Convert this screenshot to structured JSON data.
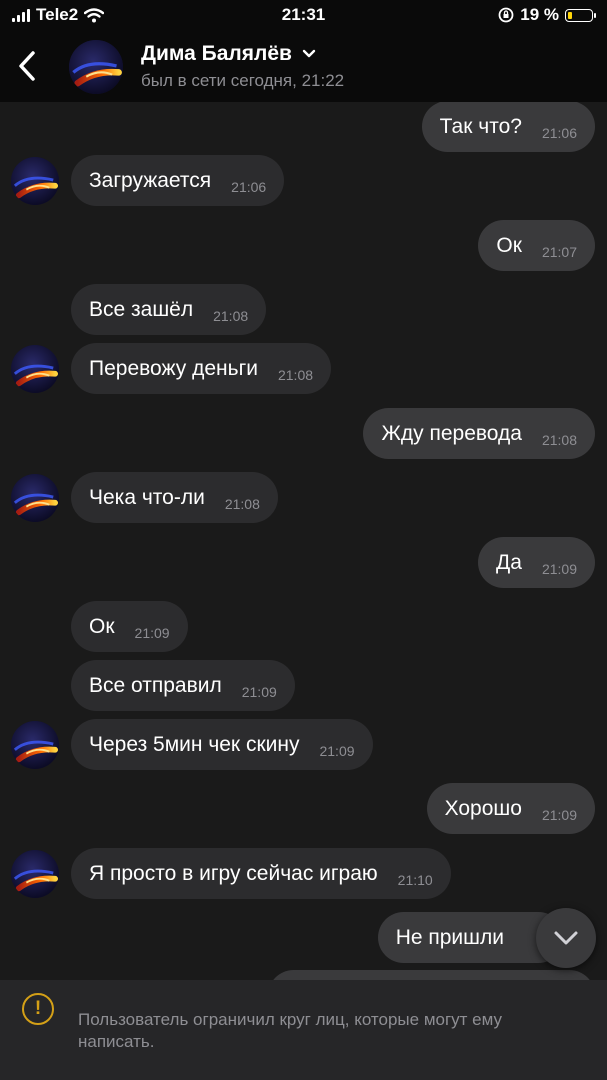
{
  "status_bar": {
    "carrier": "Tele2",
    "time": "21:31",
    "battery_percent": "19 %",
    "battery_level": 0.19,
    "battery_color": "#ffd60a"
  },
  "header": {
    "contact_name": "Дима Балялёв",
    "last_seen": "был в сети сегодня, 21:22"
  },
  "messages": [
    {
      "direction": "out",
      "text": "Так что?",
      "time": "21:06"
    },
    {
      "direction": "in",
      "text": "Загружается",
      "time": "21:06",
      "avatar": true
    },
    {
      "direction": "out",
      "text": "Ок",
      "time": "21:07"
    },
    {
      "direction": "in",
      "text": "Все зашёл",
      "time": "21:08",
      "avatar": false
    },
    {
      "direction": "in",
      "text": "Перевожу деньги",
      "time": "21:08",
      "avatar": true
    },
    {
      "direction": "out",
      "text": "Жду перевода",
      "time": "21:08"
    },
    {
      "direction": "in",
      "text": "Чека что-ли",
      "time": "21:08",
      "avatar": true
    },
    {
      "direction": "out",
      "text": "Да",
      "time": "21:09"
    },
    {
      "direction": "in",
      "text": "Ок",
      "time": "21:09",
      "avatar": false
    },
    {
      "direction": "in",
      "text": "Все отправил",
      "time": "21:09",
      "avatar": false
    },
    {
      "direction": "in",
      "text": "Через 5мин чек скину",
      "time": "21:09",
      "avatar": true
    },
    {
      "direction": "out",
      "text": "Хорошо",
      "time": "21:09"
    },
    {
      "direction": "in",
      "text": "Я просто в игру сейчас играю",
      "time": "21:10",
      "avatar": true
    },
    {
      "direction": "out",
      "text": "Не пришли",
      "time": ""
    }
  ],
  "banner": {
    "icon": "warning-icon",
    "text": "Пользователь ограничил круг лиц, которые могут ему написать."
  },
  "colors": {
    "background": "#1a1a1a",
    "incoming_bubble": "#2c2c2e",
    "outgoing_bubble": "#3a3a3c",
    "warning": "#d4a017"
  }
}
